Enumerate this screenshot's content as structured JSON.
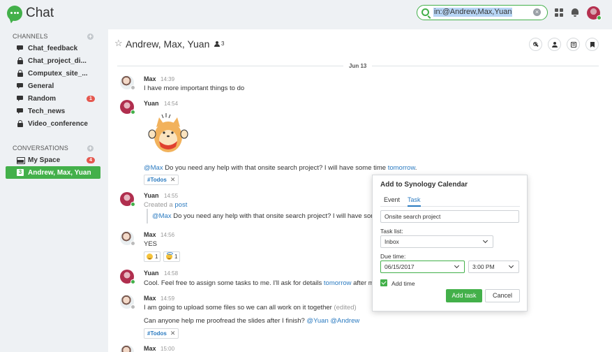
{
  "app": {
    "name": "Chat"
  },
  "search": {
    "query": "in:@Andrew,Max,Yuan"
  },
  "sidebar": {
    "channels_title": "CHANNELS",
    "channels": [
      {
        "label": "Chat_feedback",
        "icon": "channel-bubble-icon"
      },
      {
        "label": "Chat_project_di...",
        "icon": "lock-icon"
      },
      {
        "label": "Computex_site_...",
        "icon": "lock-icon"
      },
      {
        "label": "General",
        "icon": "channel-bubble-icon"
      },
      {
        "label": "Random",
        "icon": "channel-bubble-icon",
        "badge": "1"
      },
      {
        "label": "Tech_news",
        "icon": "channel-bubble-icon"
      },
      {
        "label": "Video_conference",
        "icon": "lock-icon"
      }
    ],
    "conversations_title": "CONVERSATIONS",
    "conversations": [
      {
        "label": "My Space",
        "icon": "inbox-icon",
        "badge": "4"
      },
      {
        "label": "Andrew, Max, Yuan",
        "icon": "number-icon",
        "icon_text": "3",
        "active": true
      }
    ]
  },
  "header": {
    "title": "Andrew, Max, Yuan",
    "member_count": "3"
  },
  "date_divider": "Jun 13",
  "messages": [
    {
      "user": "Max",
      "time": "14:39",
      "text": "I have more important things to do"
    },
    {
      "user": "Yuan",
      "time": "14:54",
      "mention": "@Max",
      "text": " Do you need any help with that onsite search project? I will have some time ",
      "link": "tomorrow",
      "end": ".",
      "tag": "#Todos"
    },
    {
      "user": "Yuan",
      "time": "14:55",
      "prefix": "Created a ",
      "link": "post",
      "quote_mention": "@Max",
      "quote_text": " Do you need any help with that onsite search project? I will have some time tomorrow."
    },
    {
      "user": "Max",
      "time": "14:56",
      "text": "YES",
      "reactions": [
        {
          "emoji": "grinning-emoji",
          "count": "1"
        },
        {
          "emoji": "halo-emoji",
          "count": "1"
        }
      ]
    },
    {
      "user": "Yuan",
      "time": "14:58",
      "text": "Cool. Feel free to assign some tasks to me. I'll ask for details ",
      "link": "tomorrow",
      "end": " after mornin"
    },
    {
      "user": "Max",
      "time": "14:59",
      "text": "I am going to upload some files so we can all work on it together ",
      "edited": "(edited)",
      "text2": "Can anyone help me proofread the slides after I finish? ",
      "mentions": "@Yuan @Andrew",
      "tag": "#Todos"
    },
    {
      "user": "Max",
      "time": "15:00"
    }
  ],
  "popup": {
    "title": "Add to Synology Calendar",
    "tabs": [
      "Event",
      "Task"
    ],
    "active_tab": "Task",
    "task_title": "Onsite search project",
    "task_list_label": "Task list:",
    "task_list_value": "Inbox",
    "due_label": "Due time:",
    "due_date": "06/15/2017",
    "due_time": "3:00 PM",
    "add_time_label": "Add time",
    "add_time_checked": true,
    "add_button": "Add task",
    "cancel_button": "Cancel"
  },
  "colors": {
    "accent": "#43b04a",
    "link": "#2a7ac0",
    "badge": "#e5584f"
  }
}
